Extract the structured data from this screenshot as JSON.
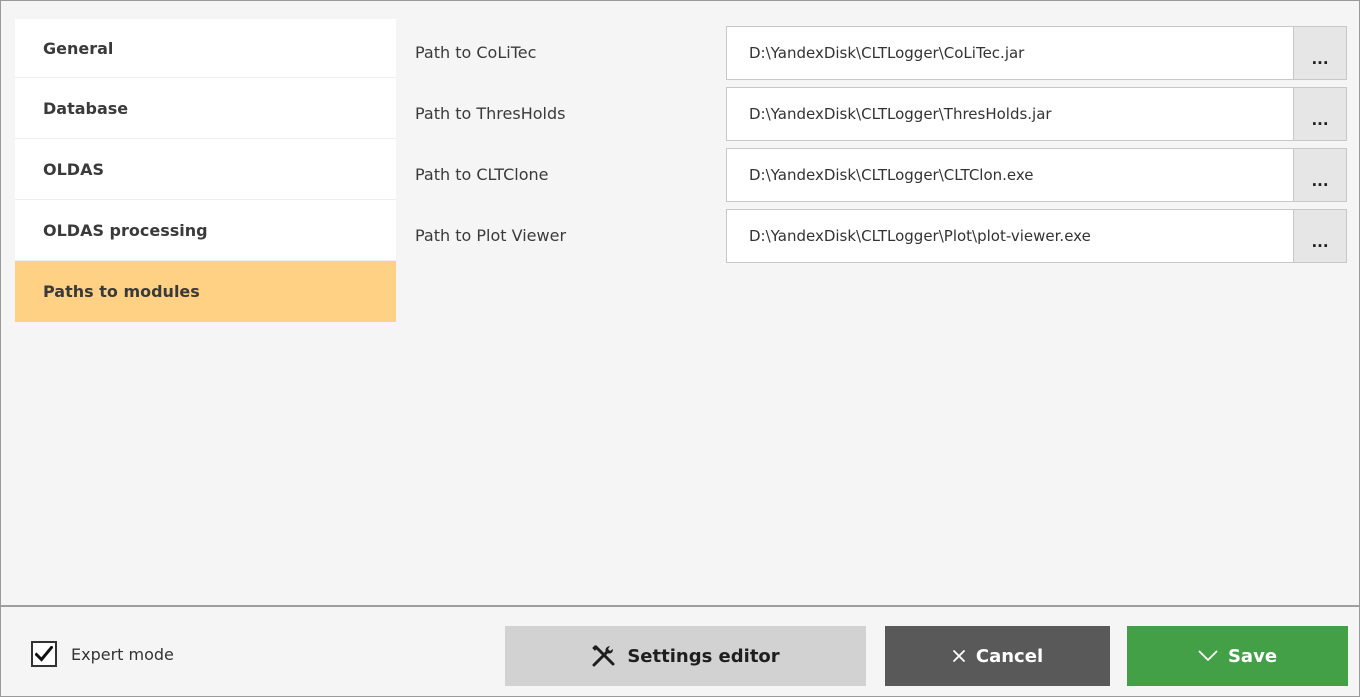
{
  "sidebar": {
    "items": [
      {
        "label": "General",
        "active": false
      },
      {
        "label": "Database",
        "active": false
      },
      {
        "label": "OLDAS",
        "active": false
      },
      {
        "label": "OLDAS processing",
        "active": false
      },
      {
        "label": "Paths to modules",
        "active": true
      }
    ]
  },
  "paths": [
    {
      "label": "Path to CoLiTec",
      "value": "D:\\YandexDisk\\CLTLogger\\CoLiTec.jar",
      "browse_label": "..."
    },
    {
      "label": "Path to ThresHolds",
      "value": "D:\\YandexDisk\\CLTLogger\\ThresHolds.jar",
      "browse_label": "..."
    },
    {
      "label": "Path to CLTClone",
      "value": "D:\\YandexDisk\\CLTLogger\\CLTClon.exe",
      "browse_label": "..."
    },
    {
      "label": "Path to Plot Viewer",
      "value": "D:\\YandexDisk\\CLTLogger\\Plot\\plot-viewer.exe",
      "browse_label": "..."
    }
  ],
  "footer": {
    "expert_mode_label": "Expert mode",
    "expert_mode_checked": true,
    "settings_editor_label": "Settings editor",
    "cancel_label": "Cancel",
    "save_label": "Save"
  },
  "colors": {
    "active_item": "#ffd184",
    "cancel_button": "#595959",
    "save_button": "#43a047",
    "settings_button": "#d2d2d2"
  },
  "icons": {
    "settings_editor": "tools-icon",
    "cancel": "close-icon",
    "save": "checkmark-icon",
    "expert_mode": "check-icon"
  }
}
